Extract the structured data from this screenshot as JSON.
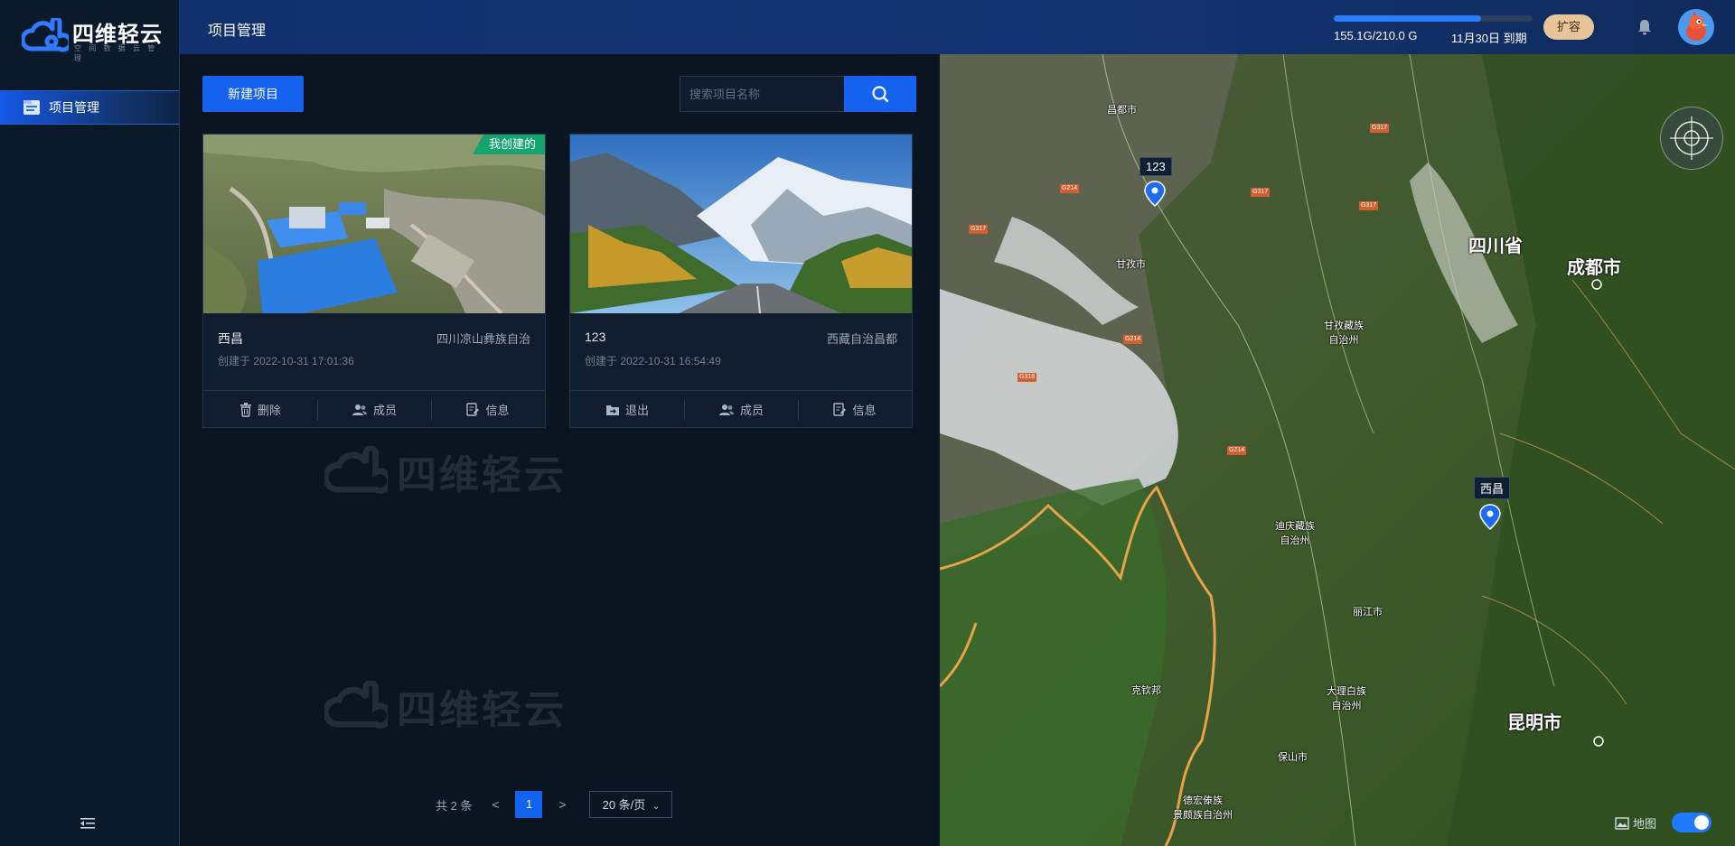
{
  "sidebar": {
    "logo": {
      "title": "四维轻云",
      "subtitle": "空 间 数 据 云 管 理"
    },
    "items": [
      {
        "label": "项目管理",
        "icon": "folder-icon"
      }
    ],
    "collapse_icon": "collapse-menu-icon"
  },
  "header": {
    "title": "项目管理",
    "storage": {
      "text": "155.1G/210.0 G",
      "used_fraction": 0.74
    },
    "expire": "11月30日 到期",
    "expand_label": "扩容"
  },
  "toolbar": {
    "new_label": "新建项目",
    "search_placeholder": "搜索项目名称"
  },
  "projects": [
    {
      "name": "西昌",
      "region": "四川凉山彝族自治",
      "created": "创建于 2022-10-31 17:01:36",
      "badge": "我创建的",
      "actions": [
        "删除",
        "成员",
        "信息"
      ]
    },
    {
      "name": "123",
      "region": "西藏自治昌都",
      "created": "创建于 2022-10-31 16:54:49",
      "badge": "",
      "actions": [
        "退出",
        "成员",
        "信息"
      ]
    }
  ],
  "pagination": {
    "total": "共 2 条",
    "prev": "<",
    "current": "1",
    "next": ">",
    "page_size": "20 条/页"
  },
  "watermark": "四维轻云",
  "map": {
    "markers": [
      "123",
      "西昌"
    ],
    "labels": {
      "sichuan": "四川省",
      "chengdu": "成都市",
      "kunming": "昆明市",
      "ganzi": "甘孜藏族\n自治州",
      "diqing": "迪庆藏族\n自治州",
      "lijiang": "丽江市",
      "dali": "大理白族\n自治州",
      "baoshan": "保山市",
      "dehong": "德宏傣族\n景颇族自治州",
      "kechin": "克钦邦",
      "changdu": "昌都市",
      "ganzi_city": "甘孜市"
    },
    "roads": [
      "G317",
      "G214",
      "G317",
      "G317",
      "G317",
      "G214",
      "G318",
      "G214"
    ],
    "toggle_label": "地图",
    "colors": {
      "accent": "#1363f0",
      "badge": "#14a56e",
      "expand": "#e7c49a"
    }
  }
}
